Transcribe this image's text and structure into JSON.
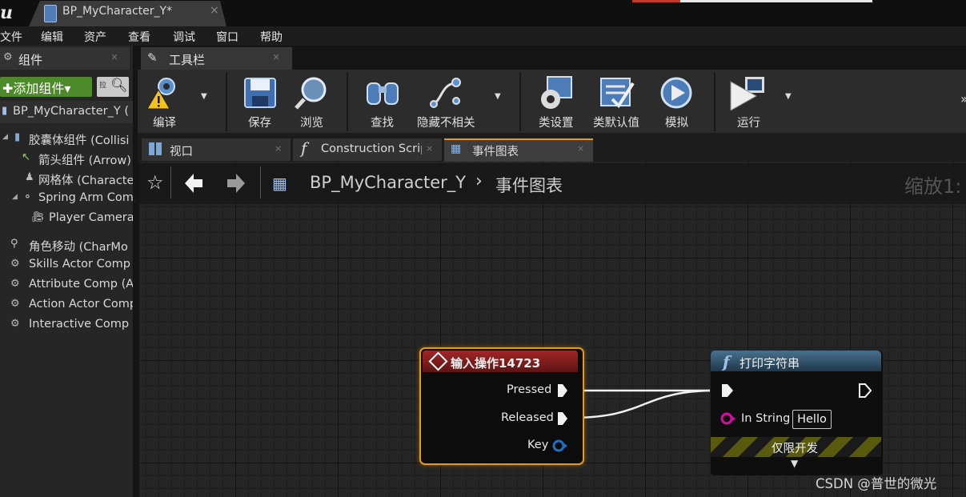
{
  "window": {
    "tab_title": "BP_MyCharacter_Y*",
    "tab_close": "×"
  },
  "menu": [
    "文件",
    "编辑",
    "资产",
    "查看",
    "调试",
    "窗口",
    "帮助"
  ],
  "components_panel": {
    "tab_label": "组件",
    "tab_close": "×",
    "add_button": "✚添加组件▾",
    "search_btn_text": "拉",
    "tree": [
      {
        "label": "BP_MyCharacter_Y (",
        "icon": "blueprint-icon"
      },
      {
        "label": "胶囊体组件 (Collisi",
        "icon": "capsule-icon"
      },
      {
        "label": "箭头组件 (Arrow)",
        "icon": "arrow-icon"
      },
      {
        "label": "网格体 (Characte",
        "icon": "mesh-icon"
      },
      {
        "label": "Spring Arm Com",
        "icon": "spring-arm-icon"
      },
      {
        "label": "Player Camera",
        "icon": "camera-icon"
      },
      {
        "label": "角色移动 (CharMo",
        "icon": "movement-icon"
      },
      {
        "label": "Skills Actor Comp",
        "icon": "component-icon"
      },
      {
        "label": "Attribute Comp (At",
        "icon": "component-icon"
      },
      {
        "label": "Action Actor Comp",
        "icon": "component-icon"
      },
      {
        "label": "Interactive Comp (",
        "icon": "component-icon"
      }
    ]
  },
  "toolbar": {
    "tab_label": "工具栏",
    "tab_close": "×",
    "buttons": [
      {
        "label": "编译",
        "icon": "compile-icon"
      },
      {
        "label": "保存",
        "icon": "save-icon"
      },
      {
        "label": "浏览",
        "icon": "browse-icon"
      },
      {
        "label": "查找",
        "icon": "find-icon"
      },
      {
        "label": "隐藏不相关",
        "icon": "hide-unrelated-icon"
      },
      {
        "label": "类设置",
        "icon": "class-settings-icon"
      },
      {
        "label": "类默认值",
        "icon": "class-defaults-icon"
      },
      {
        "label": "模拟",
        "icon": "simulate-icon"
      },
      {
        "label": "运行",
        "icon": "play-icon"
      }
    ]
  },
  "editor_tabs": [
    {
      "label": "视口",
      "icon": "viewport-icon"
    },
    {
      "label": "Construction Scrip",
      "icon": "function-icon"
    },
    {
      "label": "事件图表",
      "icon": "event-graph-icon"
    }
  ],
  "graph": {
    "breadcrumb_blueprint": "BP_MyCharacter_Y",
    "breadcrumb_separator": "›",
    "breadcrumb_graph": "事件图表",
    "zoom_label": "缩放1:"
  },
  "nodes": {
    "input_action": {
      "title": "输入操作14723",
      "pins": [
        "Pressed",
        "Released",
        "Key"
      ]
    },
    "print_string": {
      "title": "打印字符串",
      "in_string_label": "In String",
      "in_string_value": "Hello",
      "dev_only_label": "仅限开发"
    }
  },
  "colors": {
    "accent_orange": "#e69a18",
    "input_header": "#a12626",
    "function_header": "#49718f",
    "add_button_green": "#4d8a2a",
    "string_pin": "#d60ea0",
    "key_pin": "#1f6fc4"
  },
  "watermark": "CSDN @普世的微光"
}
